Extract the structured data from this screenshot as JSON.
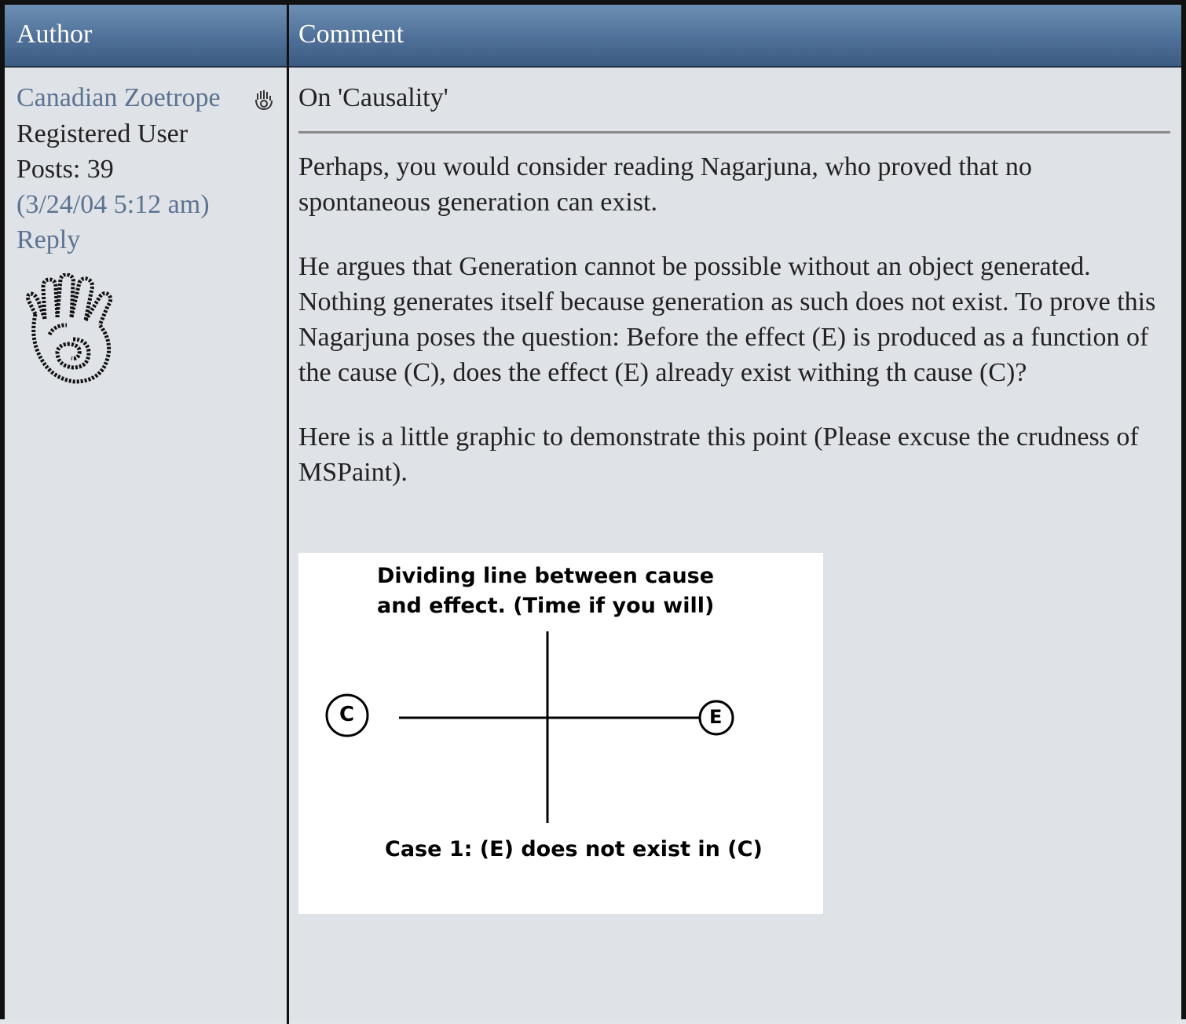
{
  "header": {
    "author_label": "Author",
    "comment_label": "Comment"
  },
  "author": {
    "name": "Canadian Zoetrope",
    "status_icon": "hand-icon",
    "role": "Registered User",
    "posts": "Posts: 39",
    "timestamp": "(3/24/04 5:12 am)",
    "reply_label": "Reply",
    "avatar": "spiral-hand-avatar"
  },
  "post": {
    "subject": "On 'Causality'",
    "paragraphs": [
      "Perhaps, you would consider reading Nagarjuna, who proved that no spontaneous generation can exist.",
      "He argues that Generation cannot be possible without an object generated. Nothing generates itself because generation as such does not exist. To prove this Nagarjuna poses the question: Before the effect (E) is produced as a function of the cause (C), does the effect (E) already exist withing th cause (C)?",
      "Here is a little graphic to demonstrate this point (Please excuse the crudness of MSPaint)."
    ],
    "diagram": {
      "title_line1": "Dividing line between cause",
      "title_line2": "and effect. (Time if you will)",
      "cause_label": "C",
      "effect_label": "E",
      "caption": "Case 1: (E) does not exist in (C)"
    }
  },
  "colors": {
    "header_top": "#6d8fb3",
    "header_bottom": "#3c5b82",
    "link": "#5b7391",
    "body_bg": "#dfe2e6"
  }
}
